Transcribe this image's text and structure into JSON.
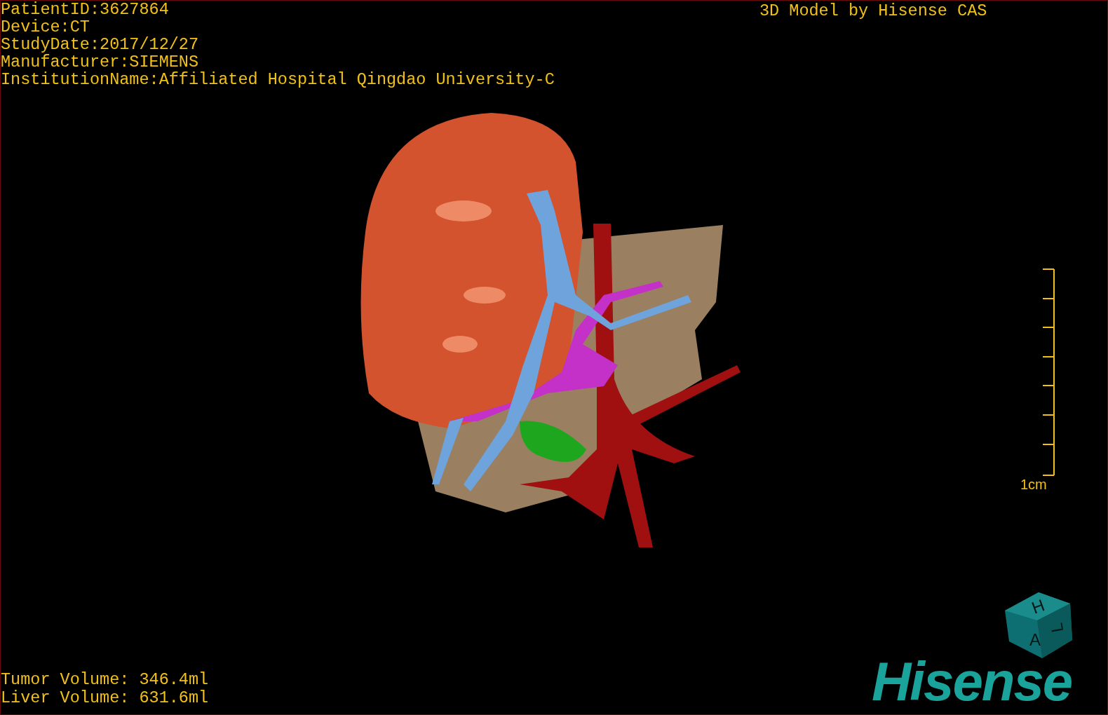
{
  "header": {
    "lines": [
      "PatientID:3627864",
      "Device:CT",
      "StudyDate:2017/12/27",
      "Manufacturer:SIEMENS",
      "InstitutionName:Affiliated Hospital Qingdao University-C"
    ]
  },
  "title": "3D Model by Hisense CAS",
  "scale_bar": {
    "label": "1cm"
  },
  "orientation_cube": {
    "labels": [
      "H",
      "A",
      "L"
    ]
  },
  "volumes": [
    "Tumor Volume: 346.4ml",
    "Liver Volume: 631.6ml"
  ],
  "logo": "Hisense"
}
